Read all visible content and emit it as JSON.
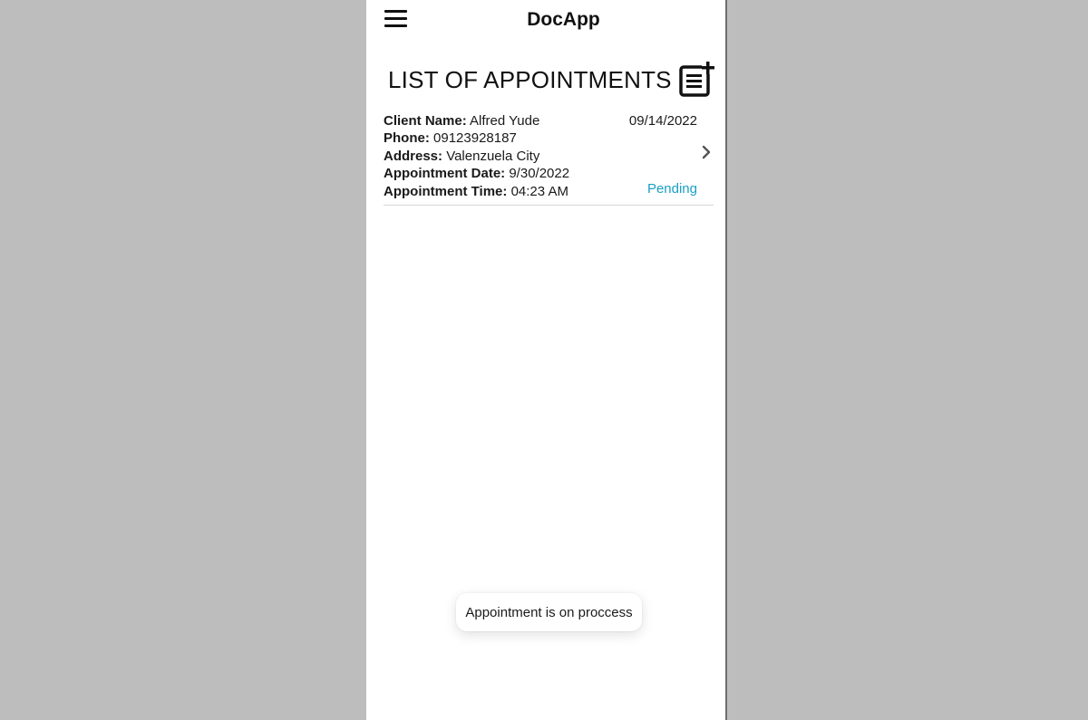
{
  "header": {
    "title": "DocApp",
    "menu_icon": "hamburger-menu-icon"
  },
  "page": {
    "title": "LIST OF APPOINTMENTS",
    "add_icon": "add-note-icon"
  },
  "appointments": [
    {
      "client_name_label": "Client Name:",
      "client_name": "Alfred Yude",
      "phone_label": "Phone:",
      "phone": "09123928187",
      "address_label": "Address:",
      "address": "Valenzuela City",
      "appt_date_label": "Appointment Date:",
      "appt_date": "9/30/2022",
      "appt_time_label": "Appointment Time:",
      "appt_time": "04:23 AM",
      "created_date": "09/14/2022",
      "status": "Pending"
    }
  ],
  "toast": {
    "message": "Appointment is on proccess"
  },
  "colors": {
    "status_pending": "#1a9fc4",
    "background": "#bdbdbd"
  }
}
